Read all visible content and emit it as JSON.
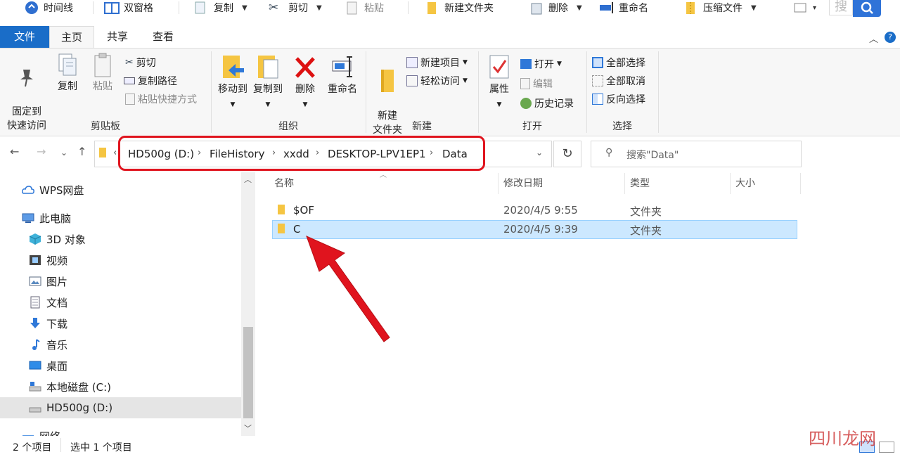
{
  "quick_toolbar": {
    "timeline": "时间线",
    "dual_pane": "双窗格",
    "copy": "复制",
    "cut": "剪切",
    "paste": "粘贴",
    "new_folder": "新建文件夹",
    "delete": "删除",
    "rename": "重命名",
    "compress": "压缩文件",
    "search_glyph": "搜"
  },
  "tabs": {
    "file": "文件",
    "home": "主页",
    "share": "共享",
    "view": "查看"
  },
  "ribbon": {
    "clipboard": {
      "pin": "固定到\n快速访问",
      "copy": "复制",
      "paste": "粘贴",
      "cut": "剪切",
      "copy_path": "复制路径",
      "paste_shortcut": "粘贴快捷方式",
      "label": "剪贴板"
    },
    "organize": {
      "move_to": "移动到",
      "copy_to": "复制到",
      "delete": "删除",
      "rename": "重命名",
      "label": "组织"
    },
    "new": {
      "new_folder": "新建\n文件夹",
      "new_item": "新建项目",
      "easy_access": "轻松访问",
      "label": "新建"
    },
    "open": {
      "properties": "属性",
      "open": "打开",
      "edit": "编辑",
      "history": "历史记录",
      "label": "打开"
    },
    "select": {
      "select_all": "全部选择",
      "select_none": "全部取消",
      "invert": "反向选择",
      "label": "选择"
    }
  },
  "address": {
    "segments": [
      "HD500g (D:)",
      "FileHistory",
      "xxdd",
      "DESKTOP-LPV1EP1",
      "Data"
    ],
    "search_placeholder": "搜索\"Data\""
  },
  "nav": [
    {
      "label": "WPS网盘",
      "icon": "cloud-icon"
    },
    {
      "label": "此电脑",
      "icon": "computer-icon"
    },
    {
      "label": "3D 对象",
      "icon": "3d-objects-icon"
    },
    {
      "label": "视频",
      "icon": "video-icon"
    },
    {
      "label": "图片",
      "icon": "pictures-icon"
    },
    {
      "label": "文档",
      "icon": "documents-icon"
    },
    {
      "label": "下载",
      "icon": "download-icon"
    },
    {
      "label": "音乐",
      "icon": "music-icon"
    },
    {
      "label": "桌面",
      "icon": "desktop-icon"
    },
    {
      "label": "本地磁盘 (C:)",
      "icon": "drive-icon"
    },
    {
      "label": "HD500g (D:)",
      "icon": "drive-icon"
    },
    {
      "label": "网络",
      "icon": "network-icon"
    }
  ],
  "columns": {
    "name": "名称",
    "modified": "修改日期",
    "type": "类型",
    "size": "大小"
  },
  "files": [
    {
      "name": "$OF",
      "modified": "2020/4/5 9:55",
      "type": "文件夹"
    },
    {
      "name": "C",
      "modified": "2020/4/5 9:39",
      "type": "文件夹"
    }
  ],
  "status": {
    "count": "2 个项目",
    "selected": "选中 1 个项目"
  },
  "watermark": "四川龙网"
}
